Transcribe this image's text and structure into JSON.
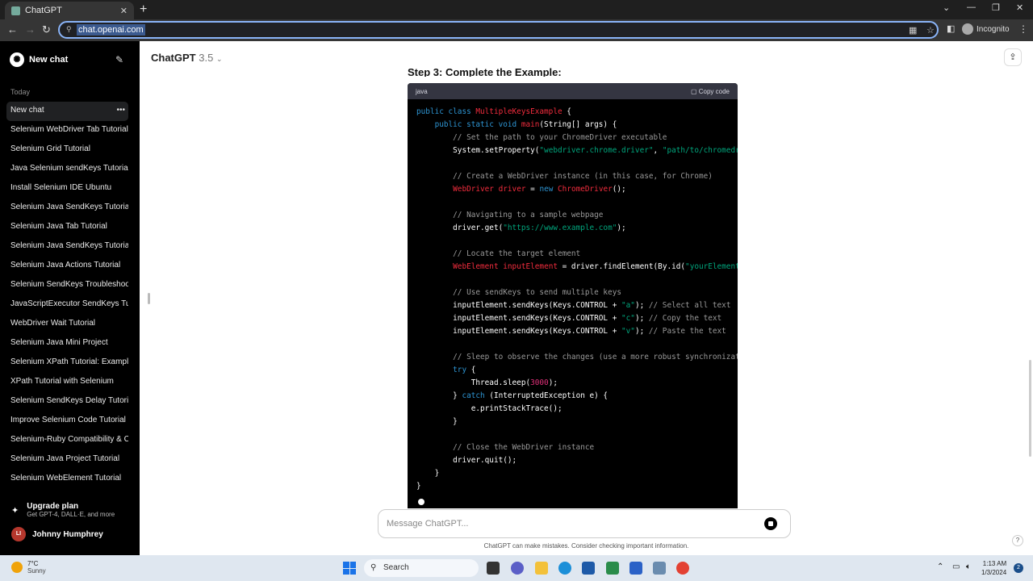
{
  "browser": {
    "tab_title": "ChatGPT",
    "url": "chat.openai.com",
    "profile": "Incognito"
  },
  "sidebar": {
    "new_chat": "New chat",
    "section_today": "Today",
    "items": [
      {
        "label": "New chat",
        "active": true
      },
      {
        "label": "Selenium WebDriver Tab Tutorial"
      },
      {
        "label": "Selenium Grid Tutorial"
      },
      {
        "label": "Java Selenium sendKeys Tutorial"
      },
      {
        "label": "Install Selenium IDE Ubuntu"
      },
      {
        "label": "Selenium Java SendKeys Tutorial"
      },
      {
        "label": "Selenium Java Tab Tutorial"
      },
      {
        "label": "Selenium Java SendKeys Tutorial"
      },
      {
        "label": "Selenium Java Actions Tutorial"
      },
      {
        "label": "Selenium SendKeys Troubleshoot"
      },
      {
        "label": "JavaScriptExecutor SendKeys Tut"
      },
      {
        "label": "WebDriver Wait Tutorial"
      },
      {
        "label": "Selenium Java Mini Project"
      },
      {
        "label": "Selenium XPath Tutorial: Example"
      },
      {
        "label": "XPath Tutorial with Selenium"
      },
      {
        "label": "Selenium SendKeys Delay Tutoria"
      },
      {
        "label": "Improve Selenium Code Tutorial"
      },
      {
        "label": "Selenium-Ruby Compatibility & C"
      },
      {
        "label": "Selenium Java Project Tutorial"
      },
      {
        "label": "Selenium WebElement Tutorial"
      }
    ],
    "upgrade_title": "Upgrade plan",
    "upgrade_sub": "Get GPT-4, DALL·E, and more",
    "user_initials": "LI",
    "user_name": "Johnny Humphrey"
  },
  "main": {
    "model_name": "ChatGPT",
    "model_version": "3.5",
    "step_heading": "Step 3: Complete the Example:",
    "code_lang": "java",
    "copy_label": "Copy code",
    "composer_placeholder": "Message ChatGPT...",
    "disclaimer": "ChatGPT can make mistakes. Consider checking important information.",
    "help": "?"
  },
  "code_lines": [
    [
      {
        "t": "public class ",
        "c": "kw"
      },
      {
        "t": "MultipleKeysExample",
        "c": "cls"
      },
      {
        "t": " {",
        "c": ""
      }
    ],
    [
      {
        "t": "    public static void ",
        "c": "kw"
      },
      {
        "t": "main",
        "c": "cls"
      },
      {
        "t": "(String[] args) {",
        "c": ""
      }
    ],
    [
      {
        "t": "        // Set the path to your ChromeDriver executable",
        "c": "cmt"
      }
    ],
    [
      {
        "t": "        System.setProperty(",
        "c": ""
      },
      {
        "t": "\"webdriver.chrome.driver\"",
        "c": "str"
      },
      {
        "t": ", ",
        "c": ""
      },
      {
        "t": "\"path/to/chromedr",
        "c": "str"
      }
    ],
    [
      {
        "t": "",
        "c": ""
      }
    ],
    [
      {
        "t": "        // Create a WebDriver instance (in this case, for Chrome)",
        "c": "cmt"
      }
    ],
    [
      {
        "t": "        ",
        "c": ""
      },
      {
        "t": "WebDriver",
        "c": "cls"
      },
      {
        "t": " ",
        "c": ""
      },
      {
        "t": "driver",
        "c": "cls"
      },
      {
        "t": " = ",
        "c": ""
      },
      {
        "t": "new",
        "c": "kw"
      },
      {
        "t": " ",
        "c": ""
      },
      {
        "t": "ChromeDriver",
        "c": "cls"
      },
      {
        "t": "();",
        "c": ""
      }
    ],
    [
      {
        "t": "",
        "c": ""
      }
    ],
    [
      {
        "t": "        // Navigating to a sample webpage",
        "c": "cmt"
      }
    ],
    [
      {
        "t": "        driver.get(",
        "c": ""
      },
      {
        "t": "\"https://www.example.com\"",
        "c": "str"
      },
      {
        "t": ");",
        "c": ""
      }
    ],
    [
      {
        "t": "",
        "c": ""
      }
    ],
    [
      {
        "t": "        // Locate the target element",
        "c": "cmt"
      }
    ],
    [
      {
        "t": "        ",
        "c": ""
      },
      {
        "t": "WebElement",
        "c": "cls"
      },
      {
        "t": " ",
        "c": ""
      },
      {
        "t": "inputElement",
        "c": "cls"
      },
      {
        "t": " = driver.findElement(By.id(",
        "c": ""
      },
      {
        "t": "\"yourElement",
        "c": "str"
      }
    ],
    [
      {
        "t": "",
        "c": ""
      }
    ],
    [
      {
        "t": "        // Use sendKeys to send multiple keys",
        "c": "cmt"
      }
    ],
    [
      {
        "t": "        inputElement.sendKeys(Keys.CONTROL + ",
        "c": ""
      },
      {
        "t": "\"a\"",
        "c": "str"
      },
      {
        "t": "); ",
        "c": ""
      },
      {
        "t": "// Select all text",
        "c": "cmt"
      }
    ],
    [
      {
        "t": "        inputElement.sendKeys(Keys.CONTROL + ",
        "c": ""
      },
      {
        "t": "\"c\"",
        "c": "str"
      },
      {
        "t": "); ",
        "c": ""
      },
      {
        "t": "// Copy the text",
        "c": "cmt"
      }
    ],
    [
      {
        "t": "        inputElement.sendKeys(Keys.CONTROL + ",
        "c": ""
      },
      {
        "t": "\"v\"",
        "c": "str"
      },
      {
        "t": "); ",
        "c": ""
      },
      {
        "t": "// Paste the text",
        "c": "cmt"
      }
    ],
    [
      {
        "t": "",
        "c": ""
      }
    ],
    [
      {
        "t": "        // Sleep to observe the changes (use a more robust synchronizat",
        "c": "cmt"
      }
    ],
    [
      {
        "t": "        ",
        "c": ""
      },
      {
        "t": "try",
        "c": "kw"
      },
      {
        "t": " {",
        "c": ""
      }
    ],
    [
      {
        "t": "            Thread.sleep(",
        "c": ""
      },
      {
        "t": "3000",
        "c": "num"
      },
      {
        "t": ");",
        "c": ""
      }
    ],
    [
      {
        "t": "        } ",
        "c": ""
      },
      {
        "t": "catch",
        "c": "kw"
      },
      {
        "t": " (InterruptedException e) {",
        "c": ""
      }
    ],
    [
      {
        "t": "            e.printStackTrace();",
        "c": ""
      }
    ],
    [
      {
        "t": "        }",
        "c": ""
      }
    ],
    [
      {
        "t": "",
        "c": ""
      }
    ],
    [
      {
        "t": "        // Close the WebDriver instance",
        "c": "cmt"
      }
    ],
    [
      {
        "t": "        driver.quit();",
        "c": ""
      }
    ],
    [
      {
        "t": "    }",
        "c": ""
      }
    ],
    [
      {
        "t": "}",
        "c": ""
      }
    ]
  ],
  "taskbar": {
    "temp": "7°C",
    "weather": "Sunny",
    "search": "Search",
    "time": "1:13 AM",
    "date": "1/3/2024",
    "notifications": "2"
  },
  "colors": {
    "keyword": "#2e95d3",
    "class": "#f22c3d",
    "string": "#00a67d",
    "comment": "#999999",
    "number": "#df3079"
  }
}
